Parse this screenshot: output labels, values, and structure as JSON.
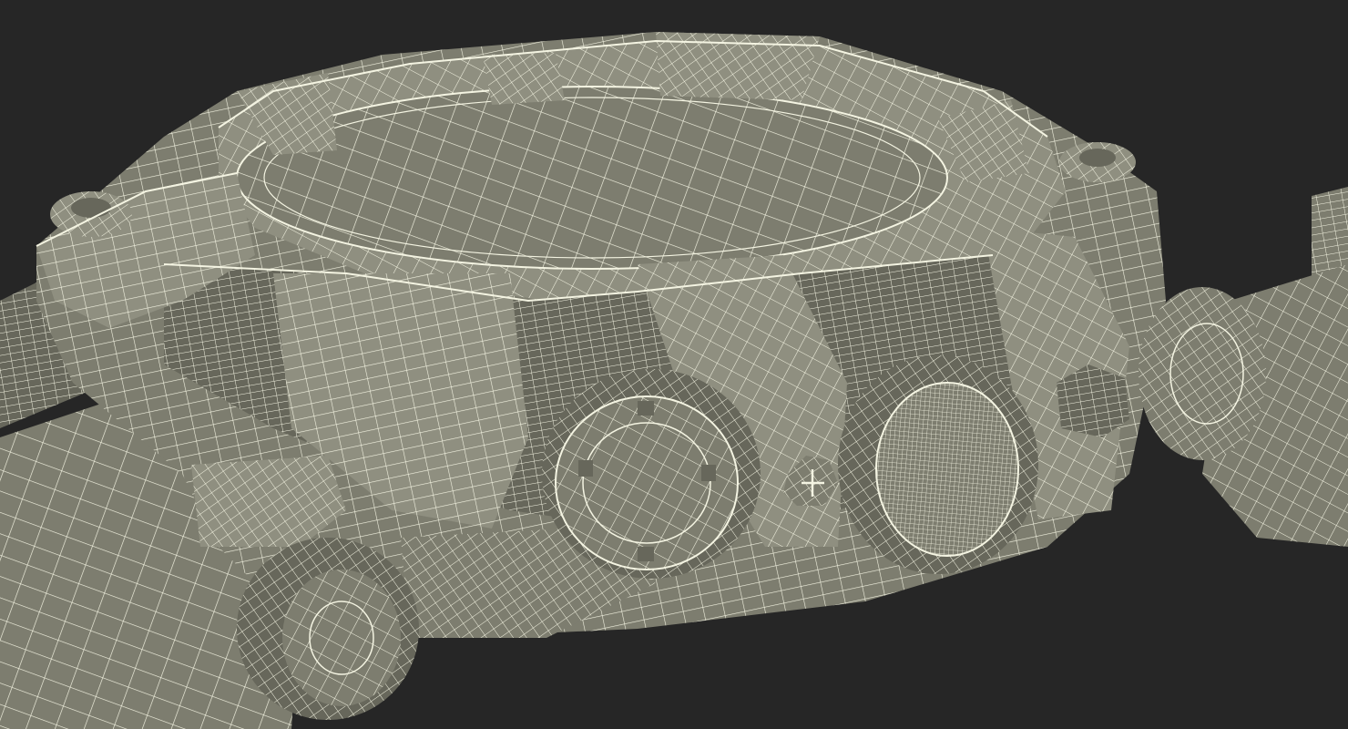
{
  "scene": {
    "background_color": "#262626",
    "surface_color": "#7d7d6f",
    "surface_dark": "#67675b",
    "surface_light": "#8f8f80",
    "wire_color": "#f4f4e2",
    "subject": "wireframe-watch-case"
  }
}
